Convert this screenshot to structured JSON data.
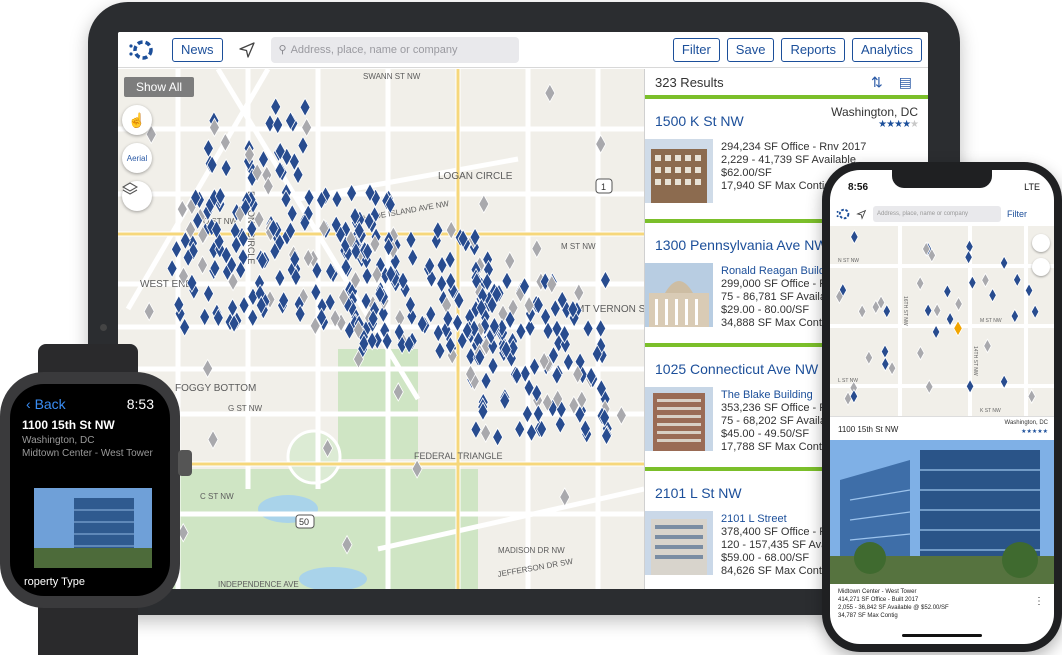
{
  "tablet": {
    "toolbar": {
      "news_label": "News",
      "search_placeholder": "Address, place, name or company",
      "buttons": [
        "Filter",
        "Save",
        "Reports",
        "Analytics"
      ]
    },
    "map": {
      "show_all_label": "Show All",
      "aerial_label": "Aerial",
      "labels": {
        "swann": "SWANN ST NW",
        "logan": "LOGAN CIRCLE",
        "dupont": "DUPONT CIRCLE",
        "rhode": "RHODE ISLAND AVE NW",
        "ostnw": "O ST NW",
        "mstnw": "M ST NW",
        "westend": "WEST END",
        "mtvernon": "MT VERNON SQUARE",
        "foggy": "FOGGY BOTTOM",
        "federal": "FEDERAL TRIANGLE",
        "gstnw": "G ST NW",
        "cstnw": "C ST NW",
        "madison": "MADISON DR NW",
        "jefferson": "JEFFERSON DR SW",
        "independence": "INDEPENDENCE AVE",
        "route1": "1",
        "route50": "50"
      }
    },
    "results": {
      "count_label": "323 Results",
      "cards": [
        {
          "title": "1500 K St NW",
          "city": "Washington, DC",
          "stars_on": "★★★★",
          "stars_off": "★",
          "subtitle": "",
          "lines": [
            "294,234 SF Office - Rnv 2017",
            "2,229 - 41,739 SF Available",
            "$62.00/SF",
            "17,940 SF Max Contig"
          ]
        },
        {
          "title": "1300 Pennsylvania Ave NW",
          "city": "",
          "stars_on": "",
          "stars_off": "",
          "subtitle": "Ronald Reagan Building",
          "lines": [
            "299,000 SF Office - R",
            "75 - 86,781 SF Availa",
            "$29.00 - 80.00/SF",
            "34,888 SF Max Contig"
          ]
        },
        {
          "title": "1025 Connecticut Ave NW",
          "city": "",
          "stars_on": "",
          "stars_off": "",
          "subtitle": "The Blake Building",
          "lines": [
            "353,236 SF Office - F",
            "75 - 68,202 SF Availa",
            "$45.00 - 49.50/SF",
            "17,788 SF Max Contig"
          ]
        },
        {
          "title": "2101 L St NW",
          "city": "",
          "stars_on": "",
          "stars_off": "",
          "subtitle": "2101 L Street",
          "lines": [
            "378,400 SF Office - F",
            "120 - 157,435 SF Avai",
            "$59.00 - 68.00/SF",
            "84,626 SF Max Contig"
          ]
        }
      ]
    }
  },
  "watch": {
    "back_label": "Back",
    "time": "8:53",
    "title": "1100 15th St NW",
    "city": "Washington, DC",
    "building": "Midtown Center - West Tower",
    "footer": "roperty Type"
  },
  "phone": {
    "time": "8:56",
    "network": "LTE",
    "search_placeholder": "Address, place, name or company",
    "filter_label": "Filter",
    "map_labels": {
      "nst": "N ST NW",
      "mst": "M ST NW",
      "lst": "L ST NW",
      "kst": "K ST NW",
      "st16": "16TH ST NW",
      "st14": "14TH ST NW"
    },
    "card": {
      "address": "1100 15th St NW",
      "city": "Washington, DC",
      "stars": "★★★★★",
      "lines": [
        "Midtown Center - West Tower",
        "414,271 SF Office - Built 2017",
        "2,055 - 36,842 SF Available @ $52.00/SF",
        "34,787 SF Max Contig"
      ]
    }
  },
  "colors": {
    "pin_blue": "#284c8f",
    "pin_grey": "#a9a9ad",
    "pin_orange": "#f2a500",
    "accent_green": "#7bbf2a",
    "brand_blue": "#1c4f9a"
  }
}
